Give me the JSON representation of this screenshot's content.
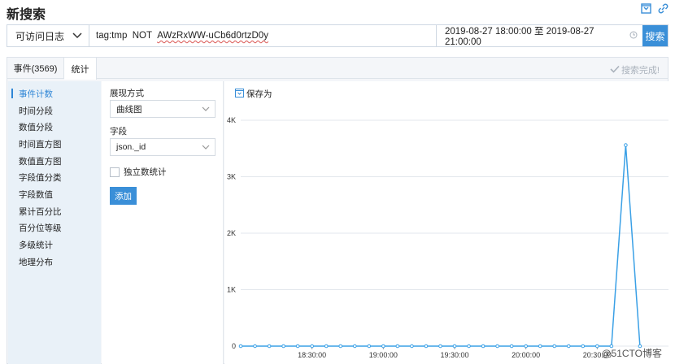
{
  "header": {
    "title": "新搜索"
  },
  "search": {
    "source": "可访问日志",
    "query_prefix": "tag:tmp  NOT  ",
    "query_term": "AWzRxWW-uCb6d0rtzD0y",
    "time_range": "2019-08-27 18:00:00 至 2019-08-27 21:00:00",
    "search_label": "搜索"
  },
  "tabs": [
    {
      "label": "事件(3569)"
    },
    {
      "label": "统计"
    }
  ],
  "status": {
    "label": "搜索完成!"
  },
  "menu": {
    "items": [
      {
        "label": "事件计数"
      },
      {
        "label": "时间分段"
      },
      {
        "label": "数值分段"
      },
      {
        "label": "时间直方图"
      },
      {
        "label": "数值直方图"
      },
      {
        "label": "字段值分类"
      },
      {
        "label": "字段数值"
      },
      {
        "label": "累计百分比"
      },
      {
        "label": "百分位等级"
      },
      {
        "label": "多级统计"
      },
      {
        "label": "地理分布"
      }
    ],
    "active_index": 0
  },
  "config": {
    "display_label": "展现方式",
    "display_value": "曲线图",
    "field_label": "字段",
    "field_value": "json._id",
    "distinct_label": "独立数统计",
    "add_label": "添加"
  },
  "chart": {
    "save_label": "保存为"
  },
  "watermark": "@51CTO博客",
  "chart_data": {
    "type": "line",
    "x_tick_labels": [
      "18:30:00",
      "19:00:00",
      "19:30:00",
      "20:00:00",
      "20:30:00"
    ],
    "x_tick_minutes": [
      30,
      60,
      90,
      120,
      150
    ],
    "x_range_minutes": [
      0,
      180
    ],
    "y_ticks": [
      0,
      1000,
      2000,
      3000,
      4000
    ],
    "y_tick_labels": [
      "0",
      "1K",
      "2K",
      "3K",
      "4K"
    ],
    "ylim": [
      0,
      4000
    ],
    "grid": true,
    "line_color": "#3aa0e6",
    "x_minutes": [
      0,
      6,
      12,
      18,
      24,
      30,
      36,
      42,
      48,
      54,
      60,
      66,
      72,
      78,
      84,
      90,
      96,
      102,
      108,
      114,
      120,
      126,
      132,
      138,
      144,
      150,
      156,
      162,
      168
    ],
    "values": [
      0,
      0,
      0,
      0,
      0,
      0,
      0,
      0,
      0,
      0,
      0,
      0,
      0,
      0,
      0,
      0,
      0,
      0,
      0,
      0,
      0,
      0,
      0,
      0,
      0,
      0,
      0,
      3560,
      0
    ]
  }
}
